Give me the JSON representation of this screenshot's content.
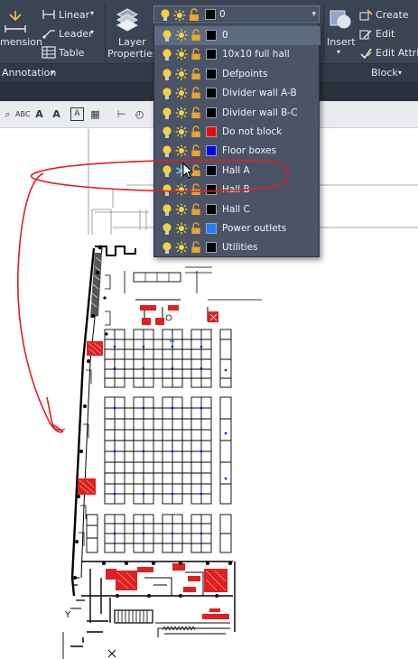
{
  "ribbon": {
    "dimension_label": "mension",
    "linear_label": "Linear",
    "leader_label": "Leader",
    "table_label": "Table",
    "annotation_panel": "Annotation",
    "layer_props_line1": "Layer",
    "layer_props_line2": "Properties",
    "insert_label": "Insert",
    "create_label": "Create",
    "edit_label": "Edit",
    "edit_attrib_label": "Edit Attrib",
    "block_panel": "Block"
  },
  "layer_dropdown": {
    "current": {
      "name": "0",
      "color": "#000000"
    },
    "items": [
      {
        "name": "0",
        "color": "#000000",
        "selected": true
      },
      {
        "name": "10x10 full hall",
        "color": "#000000"
      },
      {
        "name": "Defpoints",
        "color": "#000000"
      },
      {
        "name": "Divider wall A-B",
        "color": "#000000"
      },
      {
        "name": "Divider wall B-C",
        "color": "#000000"
      },
      {
        "name": "Do not block",
        "color": "#ff0000"
      },
      {
        "name": "Floor boxes",
        "color": "#0000ff"
      },
      {
        "name": "Hall A",
        "color": "#000000",
        "frozen": true
      },
      {
        "name": "Hall B",
        "color": "#000000"
      },
      {
        "name": "Hall C",
        "color": "#000000"
      },
      {
        "name": "Power outlets",
        "color": "#1e7fff"
      },
      {
        "name": "Utilities",
        "color": "#000000"
      }
    ]
  },
  "colors": {
    "ribbon_bg": "#3b4453",
    "dropdown_bg": "#4a5466",
    "annotation_red": "#e02020",
    "bulb_yellow": "#f5d23c",
    "lock_orange": "#e8a530",
    "freeze_blue": "#7fc4e8"
  }
}
